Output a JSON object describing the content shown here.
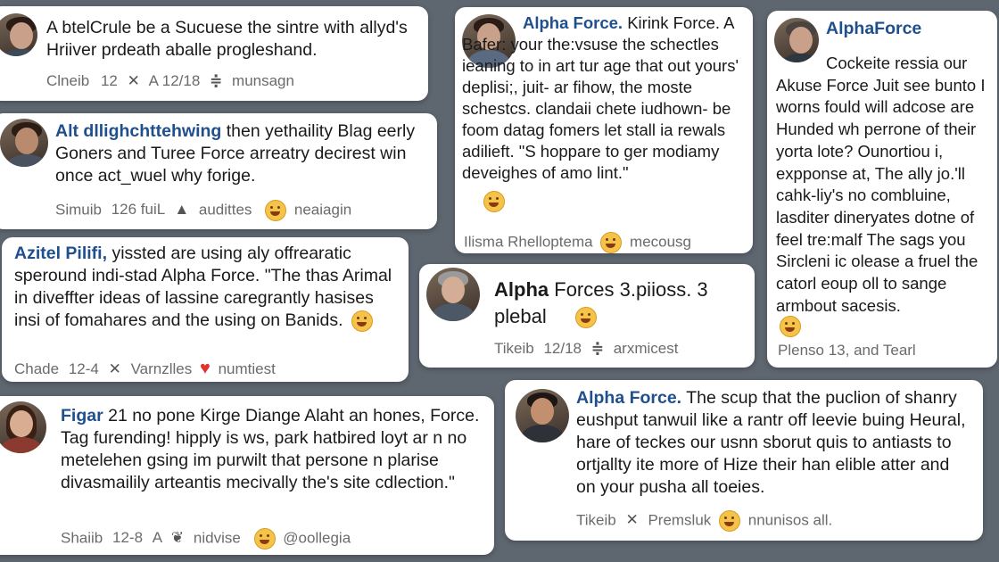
{
  "posts": [
    {
      "name": "",
      "body": "A btelCrule be a Sucuese the sintre with allyd's Hriiver prdeath aballe progleshand.",
      "meta": [
        "Clneib",
        "12",
        "A 12/18",
        "munsagn"
      ]
    },
    {
      "name": "Alpha Force.",
      "body": "Kirink Force. A Bafer: your the:vsuse the schectles ieaning to in art tur age that out yours' deplisi;, juit- ar fihow, the moste schestcs. clandaii chete iudhown- be foom datag fomers let stall ia rewals adilieft. \"S hoppare to ger modiamy deveighes of amo lint.\"",
      "meta": [
        "Ilisma Rhelloptema",
        "mecousg"
      ]
    },
    {
      "name": "AlphaForce",
      "body": "Cockeite ressia our Akuse Force Juit see bunto I worns fould will adcose are Hunded wh perrone of their yorta lote? Ounortiou i, expponse at, The ally jo.'ll cahk-liy's no combluine, lasditer dineryates dotne of feel tre:malf The sags you Sircleni ic olease a fruel the catorl eoup oll to sange armbout sacesis.",
      "meta": [
        "Plenso 13,",
        "and Tearl"
      ]
    },
    {
      "name": "Alt dllighchttehwing",
      "body": "then yethaility Blag eerly Goners and Turee Force arreatry decirest win once act_wuel why forige.",
      "meta": [
        "Simuib",
        "126 fuiL",
        "audittes",
        "neaiagin"
      ]
    },
    {
      "name": "Azitel Pilifi,",
      "body": "yissted are using aly offrearatic speround indi-stad Alpha Force. \"The thas Arimal in diveffter ideas of lassine caregrantly hasises insi of fomahares and the using on Banids.",
      "meta": [
        "Chade",
        "12-4",
        "Varnzlles",
        "numtiest"
      ]
    },
    {
      "name": "Alpha",
      "body": "Forces 3.piioss. 3 plebal",
      "meta": [
        "Tikeib",
        "12/18",
        "arxmicest"
      ]
    },
    {
      "name": "Figar",
      "body": "21 no pone Kirge Diange Alaht an hones, Force. Tag furending! hipply is ws, park hatbired loyt ar n no metelehen gsing im purwilt that persone n plarise divasmailily arteantis mecivally the's site cdlection.\"",
      "meta": [
        "Shaiib",
        "12-8",
        "A",
        "nidvise",
        "@oollegia"
      ]
    },
    {
      "name": "Alpha Force.",
      "body": "The scup that the puclion of shanry eushput tanwuil like a rantr off leevie buing Heural, hare of teckes our usnn sborut quis to antiasts to ortjallty ite more of Hize their han elible atter and on your pusha all toeies.",
      "meta": [
        "Tikeib",
        "Premsluk",
        "nnunisos all."
      ]
    }
  ],
  "colors": {
    "background": "#5e6670",
    "card": "#ffffff",
    "name": "#1f4f8c",
    "heart": "#e0332e"
  },
  "icons": {
    "reply": "reply-icon",
    "retweet": "retweet-icon",
    "emoji": "laughing-emoji-icon",
    "heart": "heart-icon"
  }
}
